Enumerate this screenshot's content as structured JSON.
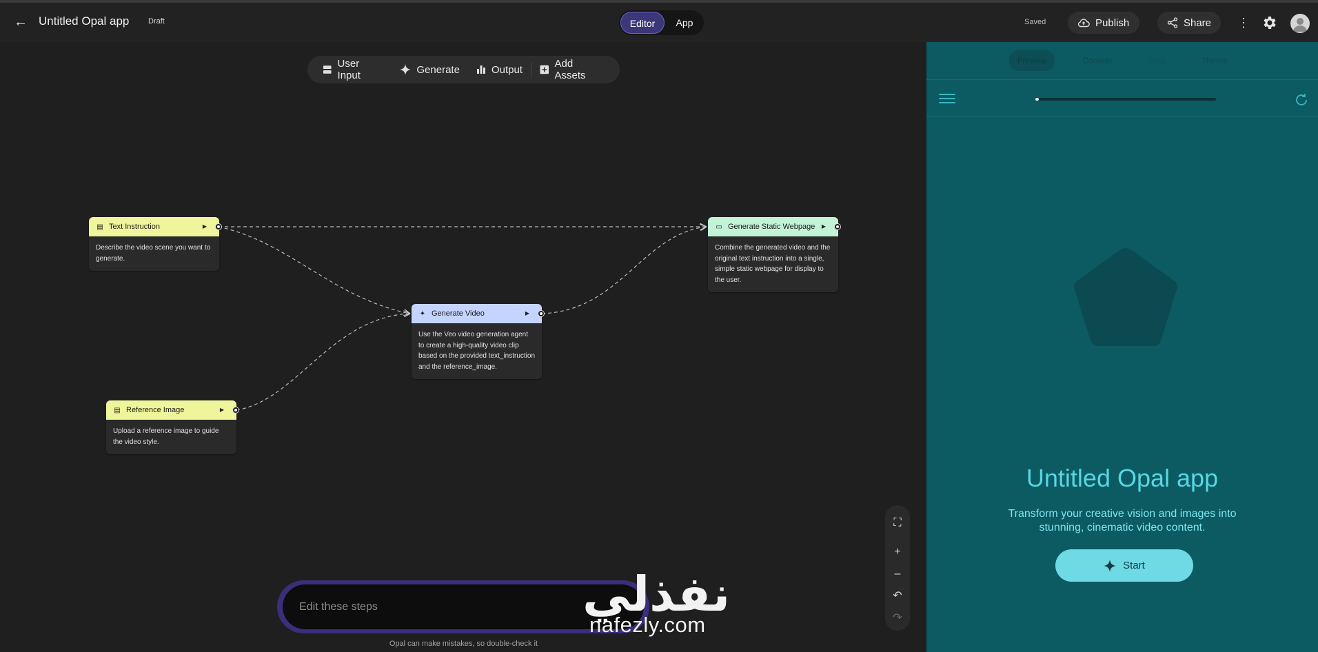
{
  "header": {
    "back_label": "←",
    "title": "Untitled Opal app",
    "draft": "Draft",
    "modes": {
      "editor": "Editor",
      "app": "App"
    },
    "saved": "Saved",
    "publish": "Publish",
    "share": "Share",
    "more": "⋮"
  },
  "toolbar": {
    "user_input": "User Input",
    "generate": "Generate",
    "output": "Output",
    "add_assets": "Add Assets"
  },
  "nodes": {
    "text_instruction": {
      "title": "Text Instruction",
      "body": "Describe the video scene you want to generate.",
      "color": "#eef59a"
    },
    "reference_image": {
      "title": "Reference Image",
      "body": "Upload a reference image to guide the video style.",
      "color": "#eef59a"
    },
    "generate_video": {
      "title": "Generate Video",
      "body": "Use the Veo video generation agent to create a high-quality video clip based on the provided text_instruction and the reference_image.",
      "color": "#c5d4ff"
    },
    "generate_webpage": {
      "title": "Generate Static Webpage",
      "body": "Combine the generated video and the original text instruction into a single, simple static webpage for display to the user.",
      "color": "#c2f3d6"
    }
  },
  "zoom_controls": {
    "fit": "⛶",
    "zoom_in": "+",
    "zoom_out": "–",
    "undo": "↶",
    "redo": "↷"
  },
  "edit": {
    "placeholder": "Edit these steps",
    "disclaimer": "Opal can make mistakes, so double-check it"
  },
  "watermark": {
    "latin": "nafezly.com",
    "arabic": "نفذلي"
  },
  "preview": {
    "tabs": [
      "Preview",
      "Console",
      "Step",
      "Theme"
    ],
    "active_tab": "Preview",
    "progress_fraction": 0.02,
    "app_title": "Untitled Opal app",
    "app_subtitle": "Transform your creative vision and images into stunning, cinematic video content.",
    "start": "Start"
  },
  "colors": {
    "accent_editor": "#3b3778",
    "preview_bg": "#0c5a62",
    "preview_title": "#58d6e3",
    "start_button": "#6fd9e4"
  }
}
